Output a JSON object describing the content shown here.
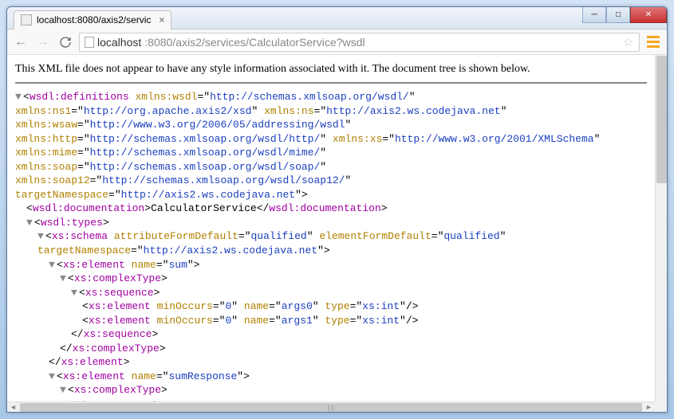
{
  "tab": {
    "title": "localhost:8080/axis2/servic"
  },
  "url": {
    "host": "localhost",
    "path": ":8080/axis2/services/CalculatorService?wsdl"
  },
  "notice": "This XML file does not appear to have any style information associated with it. The document tree is shown below.",
  "xml": {
    "defs_open": "wsdl:definitions",
    "a1n": "xmlns:wsdl",
    "a1v": "http://schemas.xmlsoap.org/wsdl/",
    "a2n": "xmlns:ns1",
    "a2v": "http://org.apache.axis2/xsd",
    "a3n": "xmlns:ns",
    "a3v": "http://axis2.ws.codejava.net",
    "a4n": "xmlns:wsaw",
    "a4v": "http://www.w3.org/2006/05/addressing/wsdl",
    "a5n": "xmlns:http",
    "a5v": "http://schemas.xmlsoap.org/wsdl/http/",
    "a6n": "xmlns:xs",
    "a6v": "http://www.w3.org/2001/XMLSchema",
    "a7n": "xmlns:mime",
    "a7v": "http://schemas.xmlsoap.org/wsdl/mime/",
    "a8n": "xmlns:soap",
    "a8v": "http://schemas.xmlsoap.org/wsdl/soap/",
    "a9n": "xmlns:soap12",
    "a9v": "http://schemas.xmlsoap.org/wsdl/soap12/",
    "a10n": "targetNamespace",
    "a10v": "http://axis2.ws.codejava.net",
    "doc_tag": "wsdl:documentation",
    "doc_text": "CalculatorService",
    "types_tag": "wsdl:types",
    "schema_tag": "xs:schema",
    "s_afd_n": "attributeFormDefault",
    "s_afd_v": "qualified",
    "s_efd_n": "elementFormDefault",
    "s_efd_v": "qualified",
    "s_tns_n": "targetNamespace",
    "s_tns_v": "http://axis2.ws.codejava.net",
    "el_tag": "xs:element",
    "el1_name_n": "name",
    "el1_name_v": "sum",
    "ct_tag": "xs:complexType",
    "seq_tag": "xs:sequence",
    "e_min_n": "minOccurs",
    "e_min_v": "0",
    "e_name_n": "name",
    "e_type_n": "type",
    "e_type_v": "xs:int",
    "e_arg0": "args0",
    "e_arg1": "args1",
    "el2_name_v": "sumResponse"
  }
}
